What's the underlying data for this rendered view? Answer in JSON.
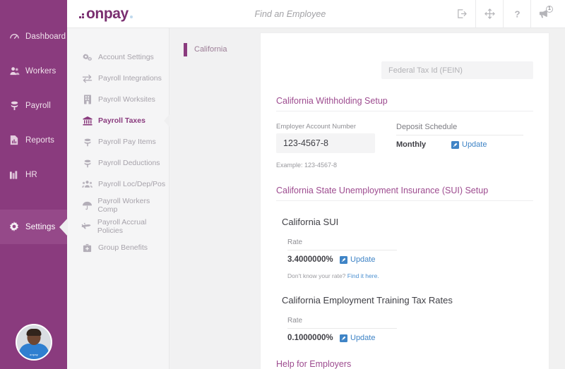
{
  "sidebar": {
    "items": [
      {
        "label": "Dashboard",
        "icon": "gauge-icon",
        "active": false
      },
      {
        "label": "Workers",
        "icon": "people-icon",
        "active": false
      },
      {
        "label": "Payroll",
        "icon": "money-stack-icon",
        "active": false
      },
      {
        "label": "Reports",
        "icon": "document-chart-icon",
        "active": false
      },
      {
        "label": "HR",
        "icon": "books-icon",
        "active": false
      },
      {
        "label": "Settings",
        "icon": "gear-icon",
        "active": true
      }
    ],
    "avatar_badge": "onpay"
  },
  "header": {
    "logo_text": "onpay",
    "search_placeholder": "Find an Employee",
    "search_value": "",
    "icons": [
      {
        "name": "logout-icon"
      },
      {
        "name": "move-icon"
      },
      {
        "name": "help-icon"
      },
      {
        "name": "megaphone-icon",
        "badge": "1"
      }
    ]
  },
  "subnav": {
    "items": [
      {
        "label": "Account Settings",
        "icon": "gears-icon",
        "active": false
      },
      {
        "label": "Payroll Integrations",
        "icon": "exchange-arrows-icon",
        "active": false
      },
      {
        "label": "Payroll Worksites",
        "icon": "building-icon",
        "active": false
      },
      {
        "label": "Payroll Taxes",
        "icon": "bank-icon",
        "active": true
      },
      {
        "label": "Payroll Pay Items",
        "icon": "money-stack-icon",
        "active": false
      },
      {
        "label": "Payroll Deductions",
        "icon": "money-stack-icon",
        "active": false
      },
      {
        "label": "Payroll Loc/Dep/Pos",
        "icon": "group-people-icon",
        "active": false
      },
      {
        "label": "Payroll Workers Comp",
        "icon": "umbrella-icon",
        "active": false
      },
      {
        "label": "Payroll Accrual Policies",
        "icon": "airplane-icon",
        "active": false
      },
      {
        "label": "Group Benefits",
        "icon": "briefcase-medical-icon",
        "active": false
      }
    ]
  },
  "state_list": {
    "items": [
      {
        "label": "California",
        "selected": true
      }
    ]
  },
  "main": {
    "fein": {
      "placeholder": "Federal Tax Id (FEIN)",
      "value": ""
    },
    "withholding": {
      "section_title": "California Withholding Setup",
      "account_label": "Employer Account Number",
      "account_value": "123-4567-8",
      "account_example": "Example: 123-4567-8",
      "deposit_label": "Deposit Schedule",
      "deposit_value": "Monthly",
      "deposit_update_label": "Update"
    },
    "sui": {
      "section_title": "California State Unemployment Insurance (SUI) Setup",
      "sub_title": "California SUI",
      "rate_label": "Rate",
      "rate_value": "3.4000000%",
      "update_label": "Update",
      "hint_text": "Don't know your rate?",
      "hint_link": "Find it here."
    },
    "ett": {
      "sub_title": "California Employment Training Tax Rates",
      "rate_label": "Rate",
      "rate_value": "0.1000000%",
      "update_label": "Update"
    },
    "help": {
      "section_title": "Help for Employers"
    }
  },
  "colors": {
    "brand_purple": "#8a3b7e",
    "heading_purple": "#9d4b8f",
    "link_blue": "#3f84c6",
    "page_bg": "#f1f1f1"
  }
}
